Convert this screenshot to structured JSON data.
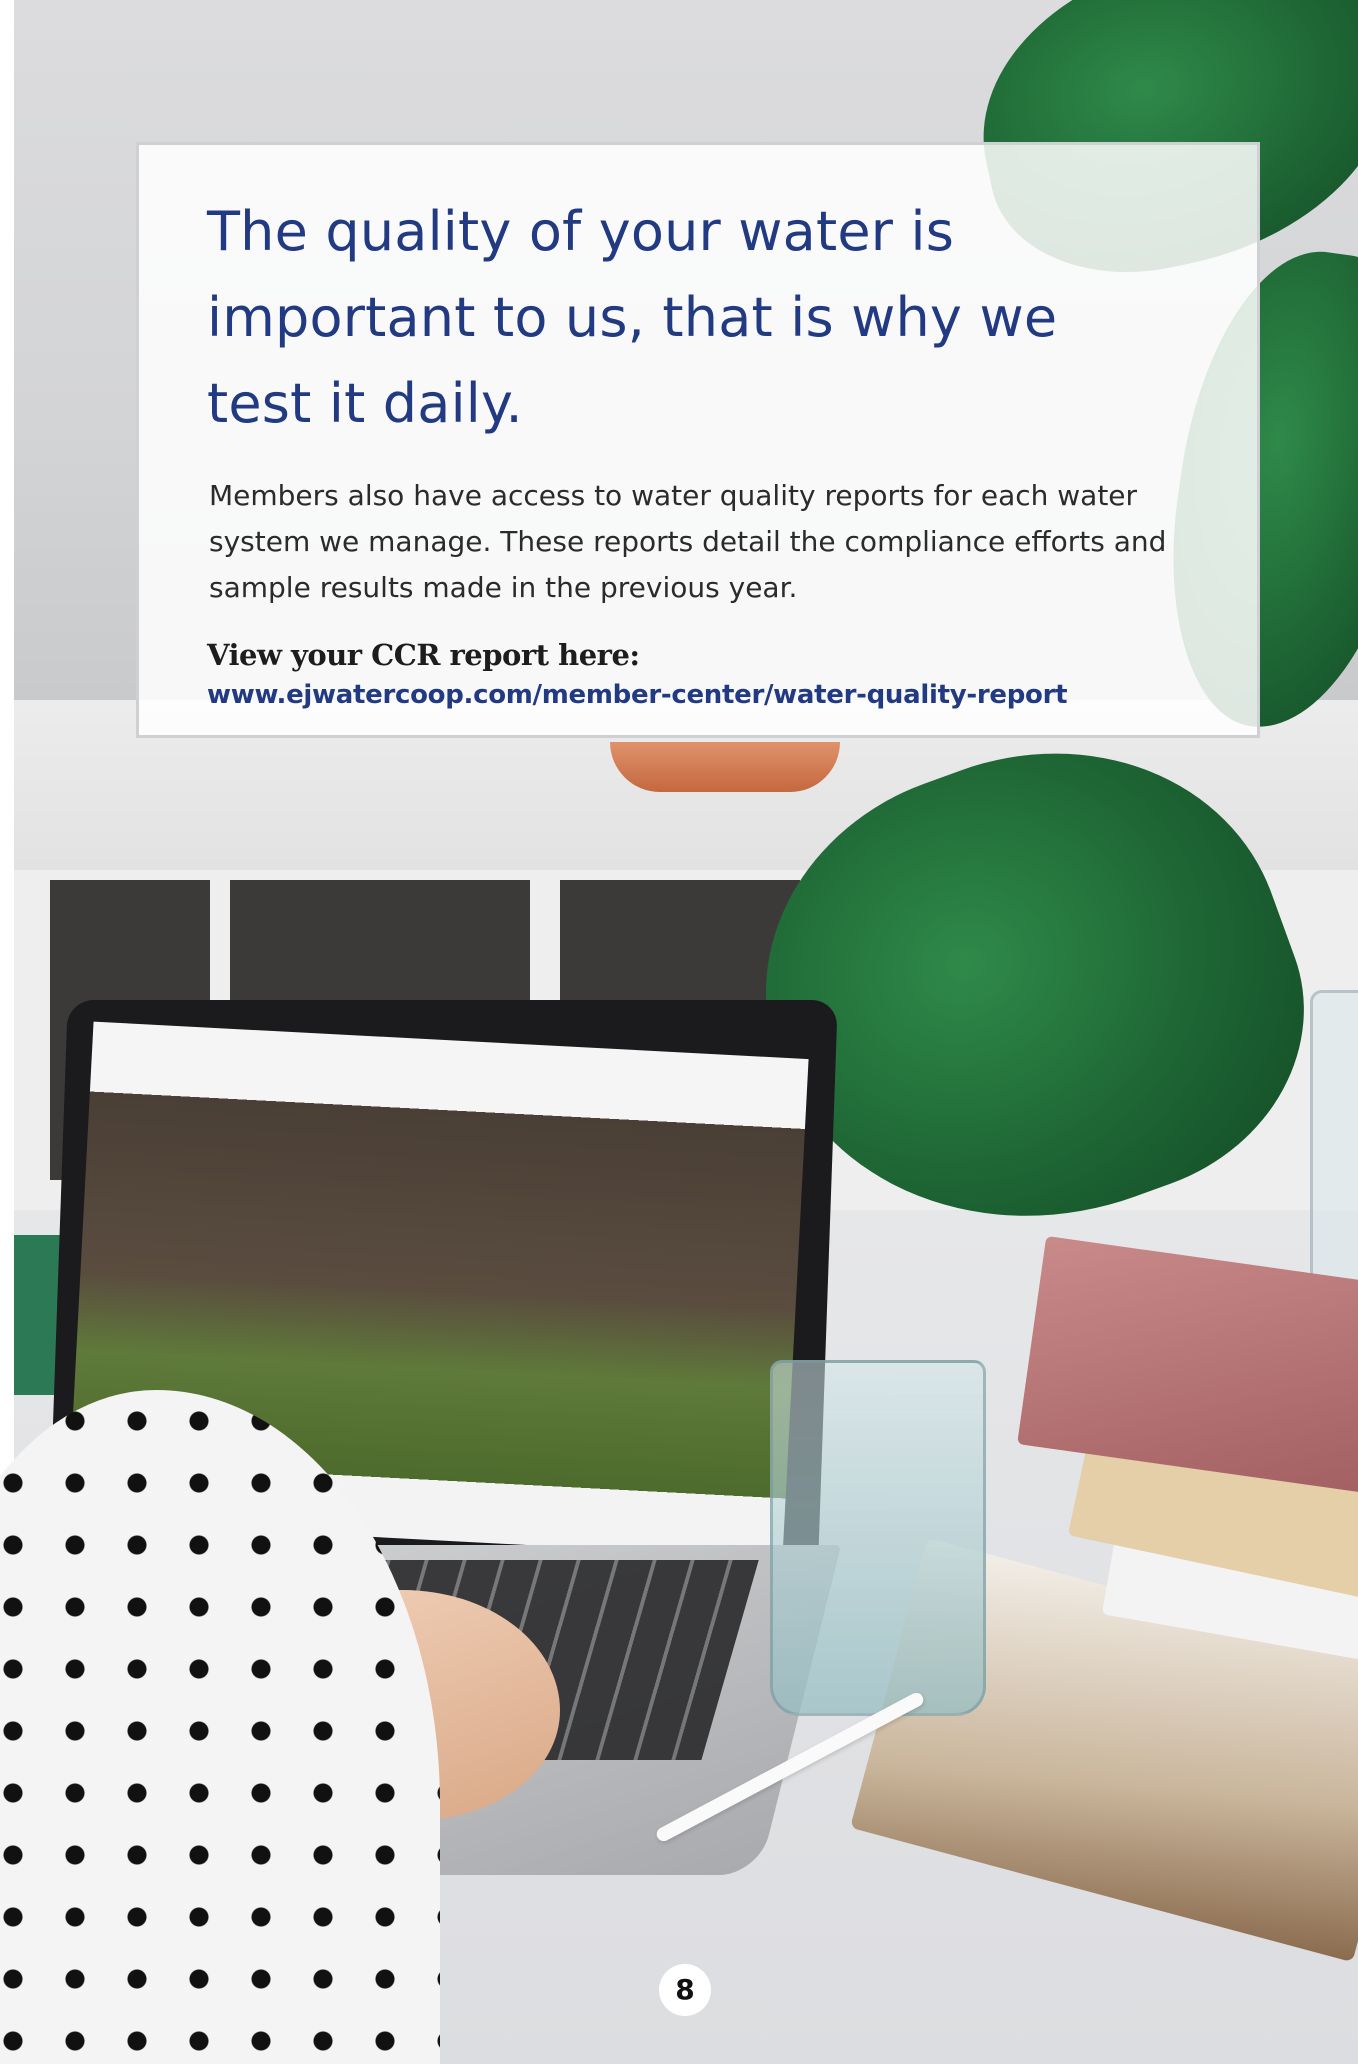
{
  "card": {
    "headline": "The quality of your water is important to us, that is why we test it daily.",
    "body": "Members also have access to water quality reports for each water system we manage. These reports detail the compliance efforts and sample results made in the previous year.",
    "ccr_label": "View your CCR report here:",
    "ccr_link": "www.ejwatercoop.com/member-center/water-quality-report"
  },
  "footer": {
    "page_number": "8"
  },
  "colors": {
    "headline": "#213a82",
    "link": "#213a82",
    "body_text": "#2b2b2b"
  }
}
